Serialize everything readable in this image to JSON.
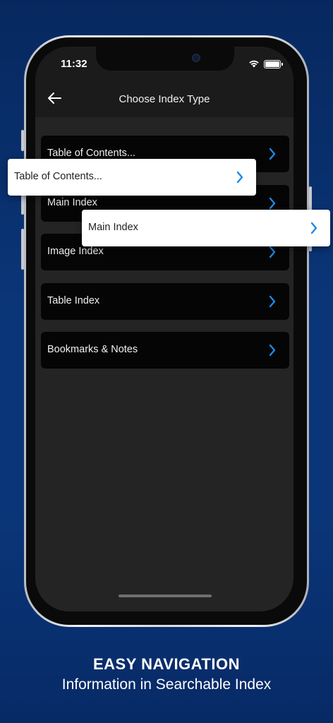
{
  "status_bar": {
    "time": "11:32"
  },
  "nav": {
    "title": "Choose Index Type"
  },
  "list_items": [
    {
      "label": "Table of Contents..."
    },
    {
      "label": "Main Index"
    },
    {
      "label": "Image Index"
    },
    {
      "label": "Table Index"
    },
    {
      "label": "Bookmarks & Notes"
    }
  ],
  "callouts": [
    {
      "label": "Table of Contents..."
    },
    {
      "label": "Main Index"
    }
  ],
  "colors": {
    "accent": "#1e88e5",
    "background": "#0a3679",
    "screen": "#242424",
    "row": "#050505"
  },
  "icons": [
    "back-arrow-icon",
    "wifi-icon",
    "battery-icon",
    "chevron-right-icon"
  ],
  "caption": {
    "headline": "EASY NAVIGATION",
    "subline": "Information in Searchable Index"
  }
}
